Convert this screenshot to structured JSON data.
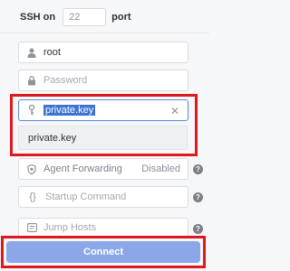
{
  "ssh": {
    "label": "SSH on",
    "port_value": "22",
    "port_suffix": "port"
  },
  "fields": {
    "username_value": "root",
    "password_placeholder": "Password",
    "private_key_value": "private.key",
    "agent_forwarding_label": "Agent Forwarding",
    "agent_forwarding_status": "Disabled",
    "startup_command_placeholder": "Startup Command",
    "jump_hosts_label": "Jump Hosts"
  },
  "dropdown": {
    "option": "private.key"
  },
  "buttons": {
    "connect": "Connect"
  },
  "colors": {
    "highlight": "#e0181c",
    "accent": "#3b74d1",
    "connect_button": "#8aa8e8"
  },
  "icons": [
    "user-icon",
    "lock-icon",
    "key-icon",
    "clear-icon",
    "shield-icon",
    "code-braces-icon",
    "jump-hosts-icon",
    "help-icon"
  ]
}
